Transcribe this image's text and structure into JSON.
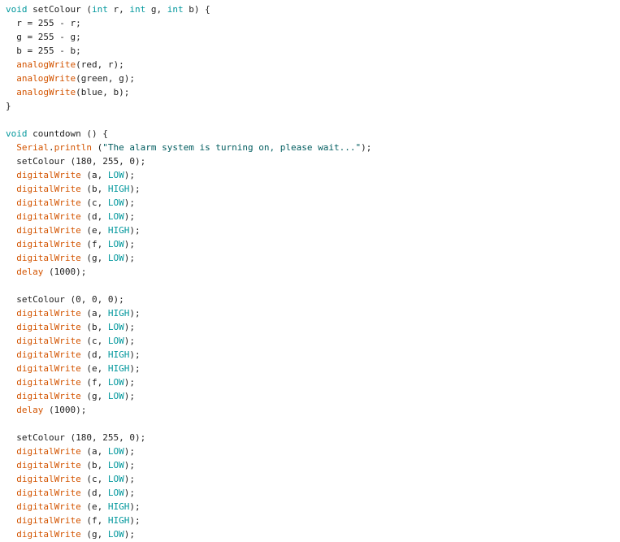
{
  "editor": {
    "colors": {
      "keyword": "#00979c",
      "function": "#d35400",
      "constant": "#00979c",
      "string": "#005c5f",
      "plain": "#1e1e1e",
      "background": "#ffffff"
    },
    "lines": [
      [
        [
          "keyword",
          "void"
        ],
        [
          "plain",
          " setColour ("
        ],
        [
          "keyword",
          "int"
        ],
        [
          "plain",
          " r, "
        ],
        [
          "keyword",
          "int"
        ],
        [
          "plain",
          " g, "
        ],
        [
          "keyword",
          "int"
        ],
        [
          "plain",
          " b) {"
        ]
      ],
      [
        [
          "plain",
          "  r = 255 - r;"
        ]
      ],
      [
        [
          "plain",
          "  g = 255 - g;"
        ]
      ],
      [
        [
          "plain",
          "  b = 255 - b;"
        ]
      ],
      [
        [
          "plain",
          "  "
        ],
        [
          "function",
          "analogWrite"
        ],
        [
          "plain",
          "(red, r);"
        ]
      ],
      [
        [
          "plain",
          "  "
        ],
        [
          "function",
          "analogWrite"
        ],
        [
          "plain",
          "(green, g);"
        ]
      ],
      [
        [
          "plain",
          "  "
        ],
        [
          "function",
          "analogWrite"
        ],
        [
          "plain",
          "(blue, b);"
        ]
      ],
      [
        [
          "plain",
          "}"
        ]
      ],
      [],
      [
        [
          "keyword",
          "void"
        ],
        [
          "plain",
          " countdown () {"
        ]
      ],
      [
        [
          "plain",
          "  "
        ],
        [
          "function",
          "Serial"
        ],
        [
          "plain",
          "."
        ],
        [
          "function",
          "println"
        ],
        [
          "plain",
          " ("
        ],
        [
          "string",
          "\"The alarm system is turning on, please wait...\""
        ],
        [
          "plain",
          ");"
        ]
      ],
      [
        [
          "plain",
          "  setColour (180, 255, 0);"
        ]
      ],
      [
        [
          "plain",
          "  "
        ],
        [
          "function",
          "digitalWrite"
        ],
        [
          "plain",
          " (a, "
        ],
        [
          "constant",
          "LOW"
        ],
        [
          "plain",
          ");"
        ]
      ],
      [
        [
          "plain",
          "  "
        ],
        [
          "function",
          "digitalWrite"
        ],
        [
          "plain",
          " (b, "
        ],
        [
          "constant",
          "HIGH"
        ],
        [
          "plain",
          ");"
        ]
      ],
      [
        [
          "plain",
          "  "
        ],
        [
          "function",
          "digitalWrite"
        ],
        [
          "plain",
          " (c, "
        ],
        [
          "constant",
          "LOW"
        ],
        [
          "plain",
          ");"
        ]
      ],
      [
        [
          "plain",
          "  "
        ],
        [
          "function",
          "digitalWrite"
        ],
        [
          "plain",
          " (d, "
        ],
        [
          "constant",
          "LOW"
        ],
        [
          "plain",
          ");"
        ]
      ],
      [
        [
          "plain",
          "  "
        ],
        [
          "function",
          "digitalWrite"
        ],
        [
          "plain",
          " (e, "
        ],
        [
          "constant",
          "HIGH"
        ],
        [
          "plain",
          ");"
        ]
      ],
      [
        [
          "plain",
          "  "
        ],
        [
          "function",
          "digitalWrite"
        ],
        [
          "plain",
          " (f, "
        ],
        [
          "constant",
          "LOW"
        ],
        [
          "plain",
          ");"
        ]
      ],
      [
        [
          "plain",
          "  "
        ],
        [
          "function",
          "digitalWrite"
        ],
        [
          "plain",
          " (g, "
        ],
        [
          "constant",
          "LOW"
        ],
        [
          "plain",
          ");"
        ]
      ],
      [
        [
          "plain",
          "  "
        ],
        [
          "function",
          "delay"
        ],
        [
          "plain",
          " (1000);"
        ]
      ],
      [],
      [
        [
          "plain",
          "  setColour (0, 0, 0);"
        ]
      ],
      [
        [
          "plain",
          "  "
        ],
        [
          "function",
          "digitalWrite"
        ],
        [
          "plain",
          " (a, "
        ],
        [
          "constant",
          "HIGH"
        ],
        [
          "plain",
          ");"
        ]
      ],
      [
        [
          "plain",
          "  "
        ],
        [
          "function",
          "digitalWrite"
        ],
        [
          "plain",
          " (b, "
        ],
        [
          "constant",
          "LOW"
        ],
        [
          "plain",
          ");"
        ]
      ],
      [
        [
          "plain",
          "  "
        ],
        [
          "function",
          "digitalWrite"
        ],
        [
          "plain",
          " (c, "
        ],
        [
          "constant",
          "LOW"
        ],
        [
          "plain",
          ");"
        ]
      ],
      [
        [
          "plain",
          "  "
        ],
        [
          "function",
          "digitalWrite"
        ],
        [
          "plain",
          " (d, "
        ],
        [
          "constant",
          "HIGH"
        ],
        [
          "plain",
          ");"
        ]
      ],
      [
        [
          "plain",
          "  "
        ],
        [
          "function",
          "digitalWrite"
        ],
        [
          "plain",
          " (e, "
        ],
        [
          "constant",
          "HIGH"
        ],
        [
          "plain",
          ");"
        ]
      ],
      [
        [
          "plain",
          "  "
        ],
        [
          "function",
          "digitalWrite"
        ],
        [
          "plain",
          " (f, "
        ],
        [
          "constant",
          "LOW"
        ],
        [
          "plain",
          ");"
        ]
      ],
      [
        [
          "plain",
          "  "
        ],
        [
          "function",
          "digitalWrite"
        ],
        [
          "plain",
          " (g, "
        ],
        [
          "constant",
          "LOW"
        ],
        [
          "plain",
          ");"
        ]
      ],
      [
        [
          "plain",
          "  "
        ],
        [
          "function",
          "delay"
        ],
        [
          "plain",
          " (1000);"
        ]
      ],
      [],
      [
        [
          "plain",
          "  setColour (180, 255, 0);"
        ]
      ],
      [
        [
          "plain",
          "  "
        ],
        [
          "function",
          "digitalWrite"
        ],
        [
          "plain",
          " (a, "
        ],
        [
          "constant",
          "LOW"
        ],
        [
          "plain",
          ");"
        ]
      ],
      [
        [
          "plain",
          "  "
        ],
        [
          "function",
          "digitalWrite"
        ],
        [
          "plain",
          " (b, "
        ],
        [
          "constant",
          "LOW"
        ],
        [
          "plain",
          ");"
        ]
      ],
      [
        [
          "plain",
          "  "
        ],
        [
          "function",
          "digitalWrite"
        ],
        [
          "plain",
          " (c, "
        ],
        [
          "constant",
          "LOW"
        ],
        [
          "plain",
          ");"
        ]
      ],
      [
        [
          "plain",
          "  "
        ],
        [
          "function",
          "digitalWrite"
        ],
        [
          "plain",
          " (d, "
        ],
        [
          "constant",
          "LOW"
        ],
        [
          "plain",
          ");"
        ]
      ],
      [
        [
          "plain",
          "  "
        ],
        [
          "function",
          "digitalWrite"
        ],
        [
          "plain",
          " (e, "
        ],
        [
          "constant",
          "HIGH"
        ],
        [
          "plain",
          ");"
        ]
      ],
      [
        [
          "plain",
          "  "
        ],
        [
          "function",
          "digitalWrite"
        ],
        [
          "plain",
          " (f, "
        ],
        [
          "constant",
          "HIGH"
        ],
        [
          "plain",
          ");"
        ]
      ],
      [
        [
          "plain",
          "  "
        ],
        [
          "function",
          "digitalWrite"
        ],
        [
          "plain",
          " (g, "
        ],
        [
          "constant",
          "LOW"
        ],
        [
          "plain",
          ");"
        ]
      ]
    ]
  }
}
